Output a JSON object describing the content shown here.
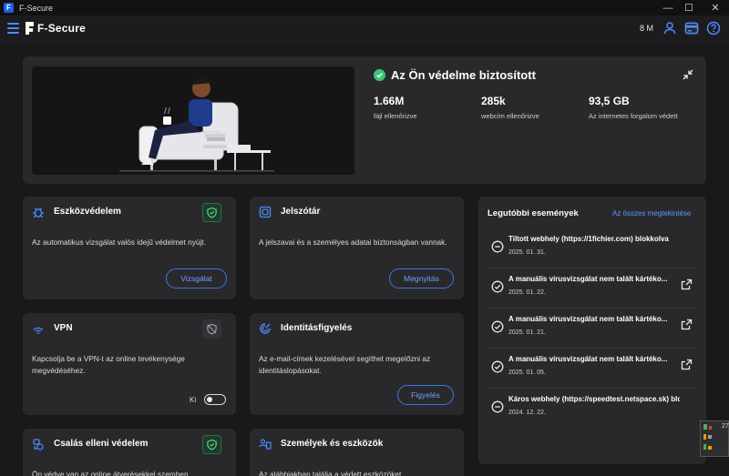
{
  "window": {
    "title": "F-Secure",
    "minimize": "—",
    "maximize": "☐",
    "close": "✕"
  },
  "header": {
    "brand": "F-Secure",
    "user_initials": "8 M"
  },
  "hero": {
    "status_title": "Az Ön védelme biztosított",
    "stats": [
      {
        "value": "1.66M",
        "label": "fájl ellenőrizve"
      },
      {
        "value": "285k",
        "label": "webcím ellenőrizve"
      },
      {
        "value": "93,5 GB",
        "label": "Az internetes forgalom védett"
      }
    ]
  },
  "cards": {
    "device": {
      "title": "Eszközvédelem",
      "text": "Az automatikus vizsgálat valós idejű védelmet nyújt.",
      "button": "Vizsgálat"
    },
    "vault": {
      "title": "Jelszótár",
      "text": "A jelszavai és a személyes adatai biztonságban vannak.",
      "button": "Megnyitás"
    },
    "vpn": {
      "title": "VPN",
      "text": "Kapcsolja be a VPN-t az online tevékenysége megvédéséhez.",
      "toggle_label": "Ki"
    },
    "identity": {
      "title": "Identitásfigyelés",
      "text": "Az e-mail-címek kezelésével segíthet megelőzni az identitáslopásokat.",
      "button": "Figyelés"
    },
    "scam": {
      "title": "Csalás elleni védelem",
      "text": "Ön védve van az online átverésekkel szemben."
    },
    "people": {
      "title": "Személyek és eszközök",
      "text": "Az alábbiakban találja a védett eszközöket."
    }
  },
  "events": {
    "title": "Legutóbbi események",
    "view_all": "Az összes megtekintése",
    "items": [
      {
        "text": "Tiltott webhely (https://1fichier.com) blokkolva",
        "date": "2025. 01. 31.",
        "icon": "minus-circle-icon",
        "external": false
      },
      {
        "text": "A manuális vírusvizsgálat nem talált kártéko...",
        "date": "2025. 01. 22.",
        "icon": "check-circle-icon",
        "external": true
      },
      {
        "text": "A manuális vírusvizsgálat nem talált kártéko...",
        "date": "2025. 01. 21.",
        "icon": "check-circle-icon",
        "external": true
      },
      {
        "text": "A manuális vírusvizsgálat nem talált kártéko...",
        "date": "2025. 01. 05.",
        "icon": "check-circle-icon",
        "external": true
      },
      {
        "text": "Káros webhely (https://speedtest.netspace.sk) blo...",
        "date": "2024. 12. 22.",
        "icon": "minus-circle-icon",
        "external": false
      }
    ]
  },
  "tray": {
    "number": "27"
  },
  "colors": {
    "accent": "#4d8cff",
    "success": "#3ec275",
    "panel": "#29292c",
    "background": "#19191b"
  }
}
